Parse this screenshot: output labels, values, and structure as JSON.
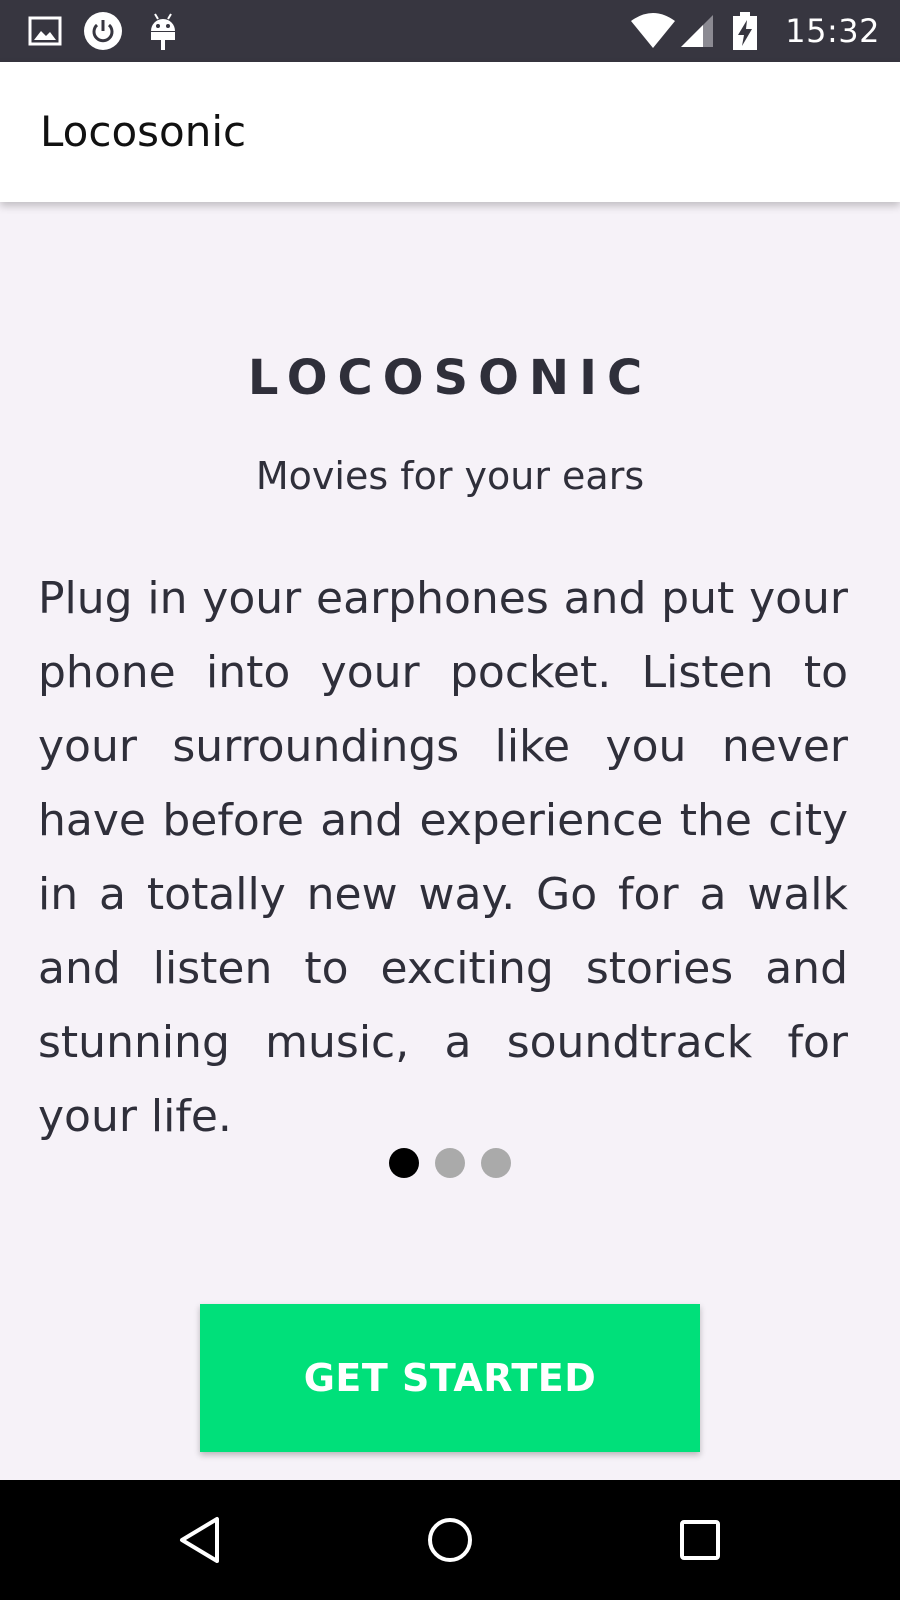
{
  "status_bar": {
    "time": "15:32",
    "icons": [
      "image-icon",
      "power-icon",
      "android-icon",
      "wifi-icon",
      "signal-icon",
      "battery-charging-icon"
    ]
  },
  "app_bar": {
    "title": "Locosonic"
  },
  "onboarding": {
    "heading": "LOCOSONIC",
    "tagline": "Movies for your ears",
    "description": "Plug in your earphones and put your phone into your pocket. Listen to your surroundings like you never have before and experience the city in a totally new way. Go for a walk and listen to exciting stories and stunning music, a soundtrack for your life.",
    "page_indicator": {
      "total": 3,
      "active": 1
    },
    "cta_label": "GET STARTED"
  },
  "nav_bar": {
    "buttons": [
      "back-icon",
      "home-icon",
      "recents-icon"
    ]
  },
  "colors": {
    "status_bar": "#373640",
    "background": "#f6f2f8",
    "accent": "#00e07a",
    "text": "#2f2f3a",
    "dot_active": "#000000",
    "dot_inactive": "#aaaaaa"
  }
}
